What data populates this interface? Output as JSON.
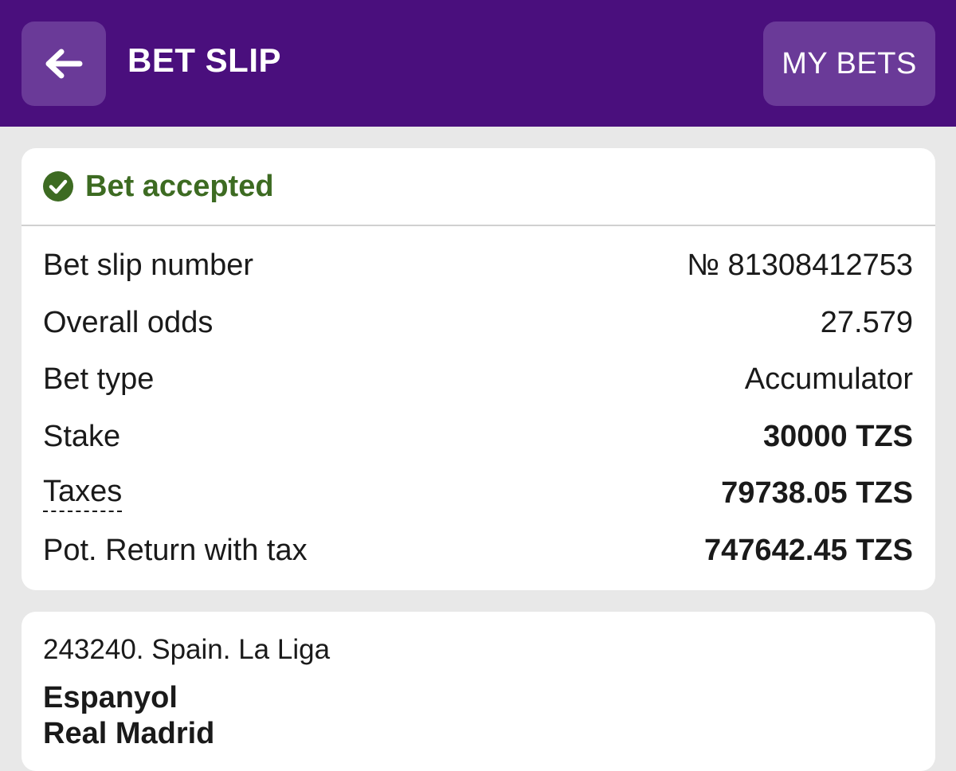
{
  "header": {
    "title": "BET SLIP",
    "my_bets_label": "MY BETS",
    "back_icon": "arrow-left-icon"
  },
  "colors": {
    "header_bg": "#4a0f7d",
    "button_bg": "#6a3a98",
    "accepted_green": "#3d6b22",
    "page_bg": "#e8e8e8"
  },
  "status": {
    "icon": "check-circle-icon",
    "text": "Bet accepted"
  },
  "summary": [
    {
      "label": "Bet slip number",
      "value": "№ 81308412753",
      "bold": false
    },
    {
      "label": "Overall odds",
      "value": "27.579",
      "bold": false
    },
    {
      "label": "Bet type",
      "value": "Accumulator",
      "bold": false
    },
    {
      "label": "Stake",
      "value": "30000 TZS",
      "bold": true
    },
    {
      "label": "Taxes",
      "value": "79738.05 TZS",
      "bold": true
    },
    {
      "label": "Pot. Return with tax",
      "value": "747642.45 TZS",
      "bold": true
    }
  ],
  "event": {
    "league": "243240. Spain. La Liga",
    "team1": "Espanyol",
    "team2": "Real Madrid"
  }
}
